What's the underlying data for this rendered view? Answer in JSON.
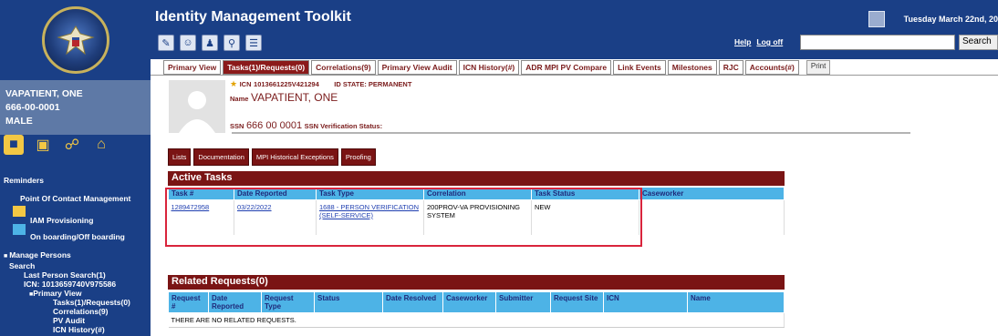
{
  "header": {
    "title": "Identity Management Toolkit",
    "date": "Tuesday March 22nd, 20",
    "help": "Help",
    "logoff": "Log off",
    "search_button": "Search",
    "search_placeholder": "",
    "toolbar_icons": [
      "notepad-icon",
      "contact-icon",
      "person-search-icon",
      "search-icon",
      "form-icon"
    ]
  },
  "sidebar": {
    "patient_name": "VAPATIENT, ONE",
    "patient_ssn": "666-00-0001",
    "patient_sex": "MALE",
    "icons": [
      "folder-icon",
      "network-icon",
      "link-icon",
      "home-icon"
    ],
    "menu": {
      "reminders": "Reminders",
      "poc": "Point Of Contact Management",
      "iam": "IAM Provisioning",
      "onboard": "On boarding/Off boarding",
      "manage": "Manage Persons",
      "search": "Search",
      "last_search": "Last Person Search(1)",
      "icn": "ICN: 1013659740V975586",
      "primary": "Primary View",
      "tasks": "Tasks(1)/Requests(0)",
      "correlations": "Correlations(9)",
      "pv_audit": "PV Audit",
      "icn_history": "ICN History(#)"
    }
  },
  "tabs": [
    {
      "label": "Primary View",
      "active": false
    },
    {
      "label": "Tasks(1)/Requests(0)",
      "active": true
    },
    {
      "label": "Correlations(9)",
      "active": false
    },
    {
      "label": "Primary View Audit",
      "active": false
    },
    {
      "label": "ICN History(#)",
      "active": false
    },
    {
      "label": "ADR MPI PV Compare",
      "active": false
    },
    {
      "label": "Link Events",
      "active": false
    },
    {
      "label": "Milestones",
      "active": false
    },
    {
      "label": "RJC",
      "active": false
    },
    {
      "label": "Accounts(#)",
      "active": false
    }
  ],
  "print_label": "Print",
  "patient": {
    "icn_label": "ICN",
    "icn_value": "1013661225V421294",
    "id_state": "ID STATE: PERMANENT",
    "name_label": "Name",
    "name_value": "VAPATIENT, ONE",
    "ssn_label": "SSN",
    "ssn_value": "666 00 0001",
    "ssn_verif": "SSN Verification Status:"
  },
  "subtabs": [
    "Lists",
    "Documentation",
    "MPI Historical Exceptions",
    "Proofing"
  ],
  "active_tasks": {
    "title": "Active Tasks",
    "columns": [
      "Task #",
      "Date Reported",
      "Task Type",
      "Correlation",
      "Task Status",
      "Caseworker"
    ],
    "rows": [
      {
        "task": "1289472958",
        "date": "03/22/2022",
        "type": "1688 - PERSON VERIFICATION (SELF-SERVICE)",
        "correlation": "200PROV-VA PROVISIONING SYSTEM",
        "status": "NEW",
        "caseworker": ""
      }
    ]
  },
  "related_requests": {
    "title": "Related Requests(0)",
    "columns": [
      "Request #",
      "Date Reported",
      "Request Type",
      "Status",
      "Date Resolved",
      "Caseworker",
      "Submitter",
      "Request Site",
      "ICN",
      "Name"
    ],
    "empty_message": "THERE ARE NO RELATED REQUESTS."
  },
  "colors": {
    "navy": "#1a3f86",
    "maroon": "#7a1414",
    "header_blue": "#4db3e6",
    "highlight": "#d9243c"
  }
}
